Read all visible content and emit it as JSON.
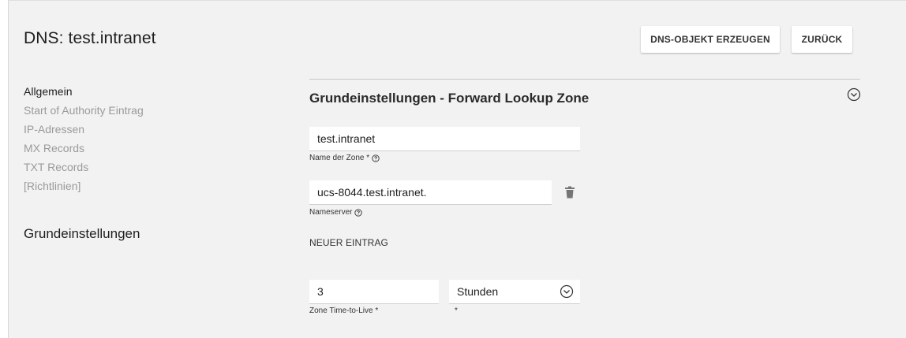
{
  "header": {
    "title": "DNS: test.intranet",
    "create_button": "DNS-OBJEKT ERZEUGEN",
    "back_button": "ZURÜCK"
  },
  "nav": {
    "items": [
      {
        "label": "Allgemein",
        "active": true
      },
      {
        "label": "Start of Authority Eintrag",
        "active": false
      },
      {
        "label": "IP-Adressen",
        "active": false
      },
      {
        "label": "MX Records",
        "active": false
      },
      {
        "label": "TXT Records",
        "active": false
      },
      {
        "label": "[Richtlinien]",
        "active": false
      }
    ],
    "group_label": "Grundeinstellungen"
  },
  "section": {
    "title": "Grundeinstellungen - Forward Lookup Zone",
    "zone_name": {
      "value": "test.intranet",
      "label": "Name der Zone *"
    },
    "nameserver": {
      "value": "ucs-8044.test.intranet.",
      "label": "Nameserver"
    },
    "new_entry": "NEUER EINTRAG",
    "ttl": {
      "value": "3",
      "label": "Zone Time-to-Live *"
    },
    "ttl_unit": {
      "value": "Stunden",
      "label": "*"
    }
  },
  "icons": {
    "collapse": "chevron-circle-down-icon",
    "help": "question-circle-icon",
    "delete": "trash-icon",
    "dropdown": "chevron-circle-down-icon"
  }
}
